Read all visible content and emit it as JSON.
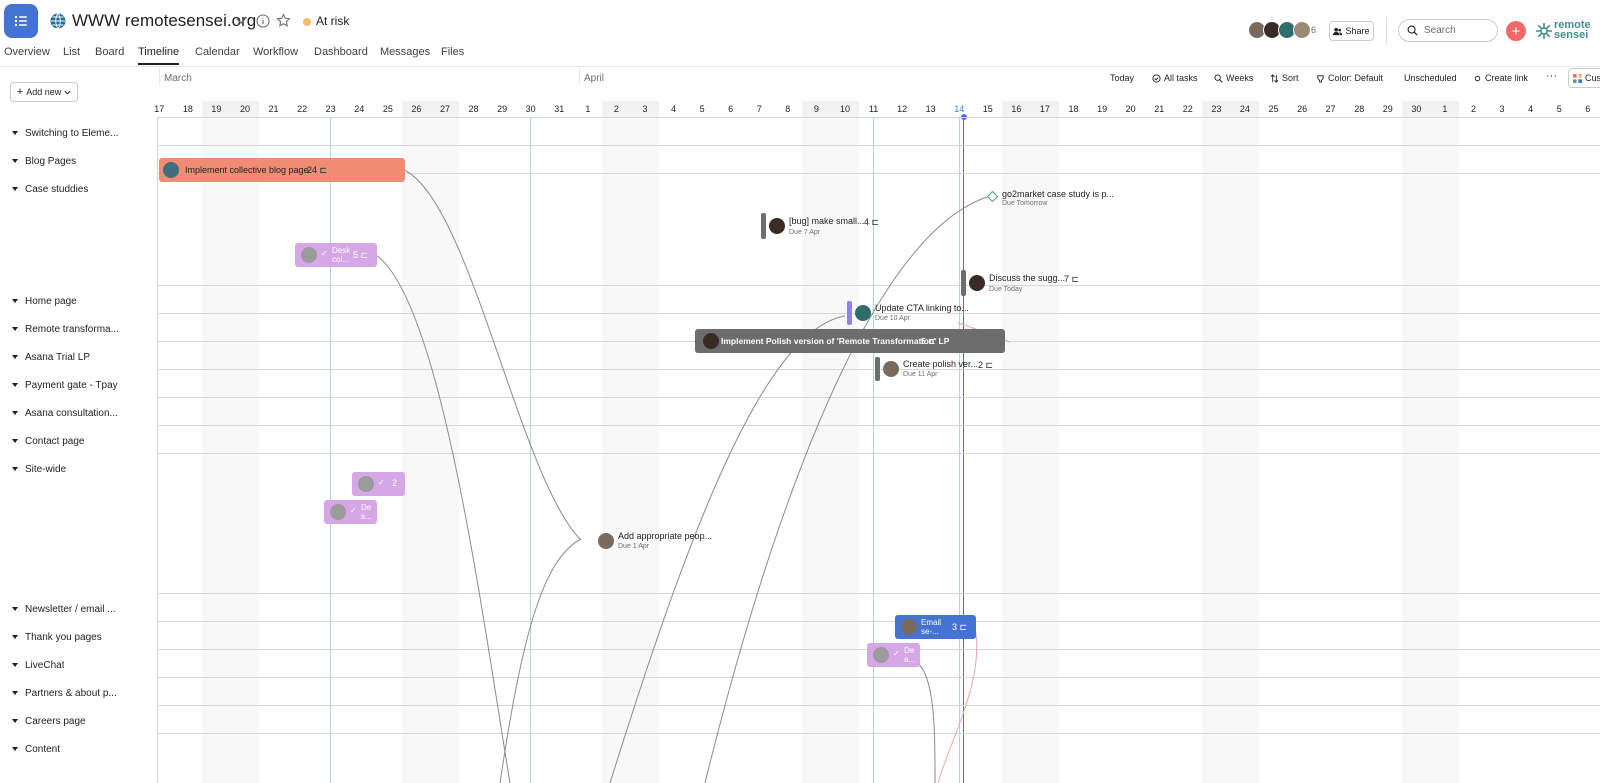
{
  "header": {
    "project_title": "WWW remotesensei.org",
    "status": "At risk",
    "status_color": "#f1bd6c",
    "member_count": "6",
    "share_label": "Share",
    "search_placeholder": "Search",
    "add_label": "+",
    "brand_line1": "remote",
    "brand_line2": "sensei",
    "app_icon": "list-icon"
  },
  "nav_tabs": [
    {
      "label": "Overview"
    },
    {
      "label": "List"
    },
    {
      "label": "Board"
    },
    {
      "label": "Timeline",
      "active": true
    },
    {
      "label": "Calendar"
    },
    {
      "label": "Workflow"
    },
    {
      "label": "Dashboard"
    },
    {
      "label": "Messages"
    },
    {
      "label": "Files"
    }
  ],
  "toolbar": {
    "add_new": "Add new",
    "months": [
      "March",
      "April"
    ],
    "buttons": {
      "today": "Today",
      "all_tasks": "All tasks",
      "weeks": "Weeks",
      "sort": "Sort",
      "color": "Color: Default",
      "unscheduled": "Unscheduled",
      "create_link": "Create link",
      "more": "···",
      "customize": "Cus"
    }
  },
  "days": [
    "17",
    "18",
    "19",
    "20",
    "21",
    "22",
    "23",
    "24",
    "25",
    "26",
    "27",
    "28",
    "29",
    "30",
    "31",
    "1",
    "2",
    "3",
    "4",
    "5",
    "6",
    "7",
    "8",
    "9",
    "10",
    "11",
    "12",
    "13",
    "14",
    "15",
    "16",
    "17",
    "18",
    "19",
    "20",
    "21",
    "22",
    "23",
    "24",
    "25",
    "26",
    "27",
    "28",
    "29",
    "30",
    "1",
    "2",
    "3",
    "4",
    "5",
    "6"
  ],
  "today_label": "14",
  "sections": [
    {
      "name": "Switching to Eleme..."
    },
    {
      "name": "Blog Pages"
    },
    {
      "name": "Case studdies"
    },
    {
      "name": "Home page"
    },
    {
      "name": "Remote transforma..."
    },
    {
      "name": "Asana Trial LP"
    },
    {
      "name": "Payment gate - Tpay"
    },
    {
      "name": "Asana consultation..."
    },
    {
      "name": "Contact page"
    },
    {
      "name": "Site-wide"
    },
    {
      "name": "Newsletter / email ..."
    },
    {
      "name": "Thank you pages"
    },
    {
      "name": "LiveChat"
    },
    {
      "name": "Partners & about p..."
    },
    {
      "name": "Careers page"
    },
    {
      "name": "Content"
    }
  ],
  "tasks": {
    "blog_bar": {
      "title": "Implement collective blog page",
      "count": "24",
      "color": "#f08c73"
    },
    "desk_bar": {
      "title": "Desk col...",
      "count": "5",
      "color": "#d6a7e6"
    },
    "bug_task": {
      "title": "[bug] make small...",
      "count": "4",
      "due": "Due 7 Apr"
    },
    "go2market": {
      "title": "go2market case study is p...",
      "due": "Due Tomorrow"
    },
    "discuss_task": {
      "title": "Discuss the sugg...",
      "count": "7",
      "due": "Due Today"
    },
    "update_cta": {
      "title": "Update CTA linking to...",
      "due": "Due 10 Apr"
    },
    "polish_lp": {
      "title": "Implement Polish version of 'Remote Transformation' LP",
      "count": "5",
      "color": "#6d6d6d"
    },
    "create_polish": {
      "title": "Create polish ver...",
      "count": "2",
      "due": "Due 11 Apr"
    },
    "site_bar1": {
      "title": "",
      "count": "2",
      "color": "#d6a7e6"
    },
    "site_bar2": {
      "title": "De s...",
      "color": "#d6a7e6"
    },
    "add_people": {
      "title": "Add appropriate peop...",
      "due": "Due 1 Apr"
    },
    "email_bar": {
      "title": "Email se-...",
      "count": "3",
      "color": "#4573d2"
    },
    "thanks_bar": {
      "title": "De a...",
      "color": "#d6a7e6"
    }
  }
}
